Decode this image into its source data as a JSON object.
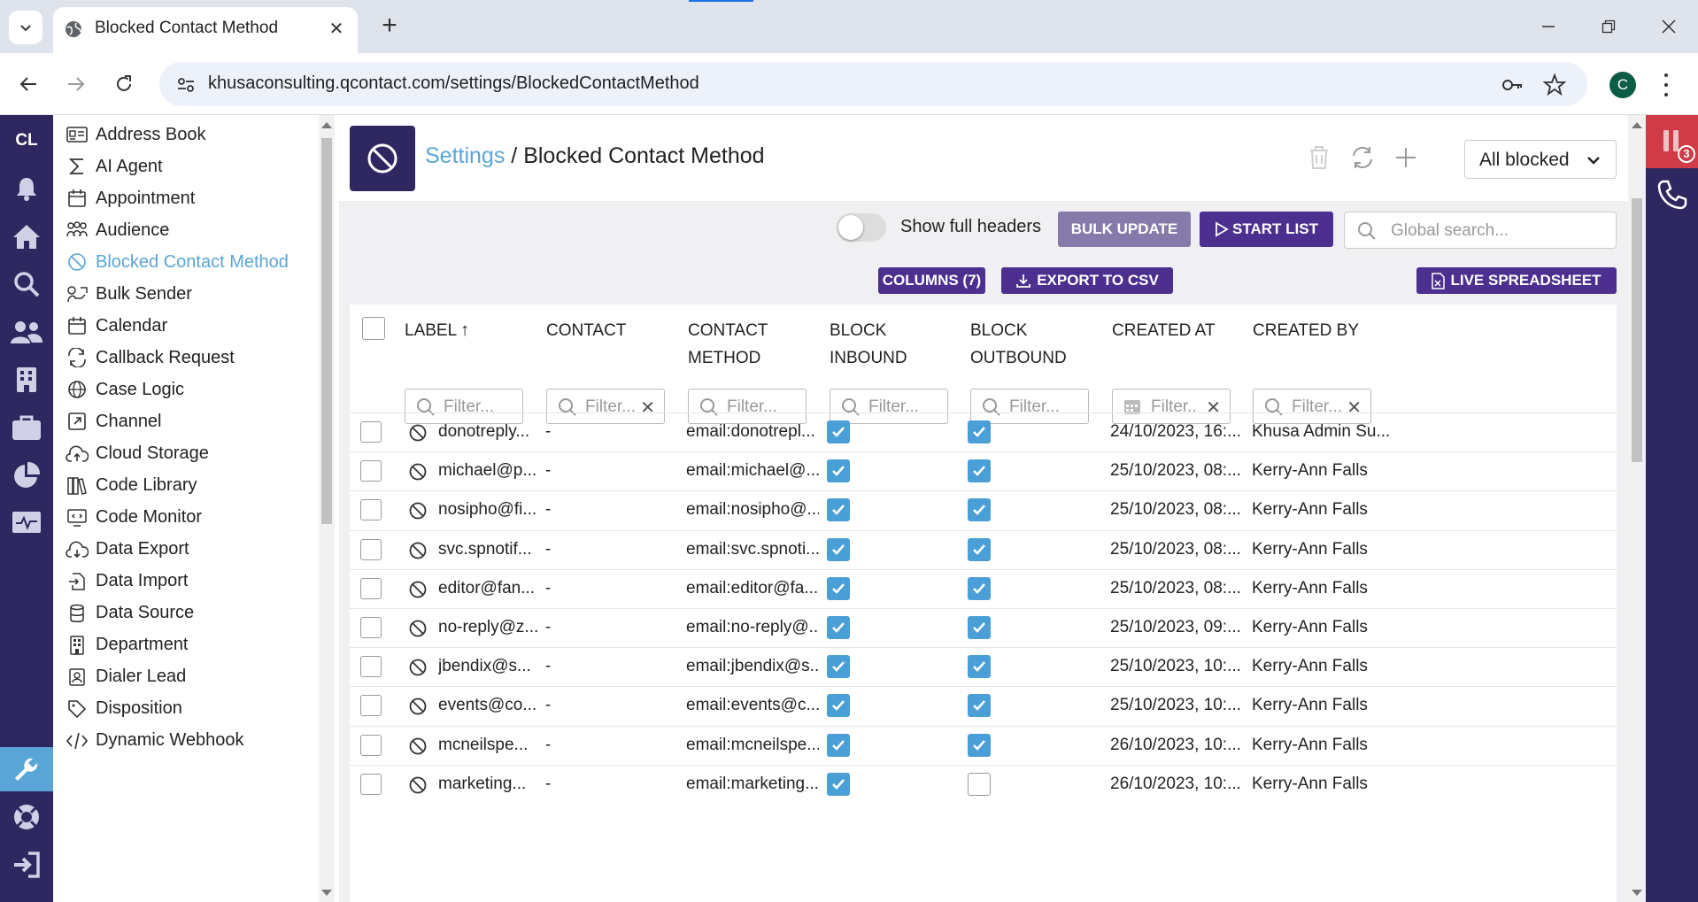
{
  "browser": {
    "tab_title": "Blocked Contact Method",
    "url": "khusaconsulting.qcontact.com/settings/BlockedContactMethod",
    "profile_initial": "C"
  },
  "app": {
    "logo": "CL",
    "rail_icons": [
      "bell-icon",
      "home-icon",
      "search-icon",
      "users-icon",
      "building-icon",
      "briefcase-icon",
      "pie-chart-icon",
      "monitor-icon",
      "wrench-icon",
      "lifebuoy-icon",
      "logout-icon"
    ],
    "active_rail": "wrench-icon",
    "notification_count": "3"
  },
  "menu": {
    "items": [
      {
        "label": "Address Book",
        "icon": "address-card-icon"
      },
      {
        "label": "AI Agent",
        "icon": "sigma-icon"
      },
      {
        "label": "Appointment",
        "icon": "calendar-icon"
      },
      {
        "label": "Audience",
        "icon": "audience-icon"
      },
      {
        "label": "Blocked Contact Method",
        "icon": "ban-icon",
        "active": true
      },
      {
        "label": "Bulk Sender",
        "icon": "bulk-sender-icon"
      },
      {
        "label": "Calendar",
        "icon": "calendar-icon"
      },
      {
        "label": "Callback Request",
        "icon": "callback-icon"
      },
      {
        "label": "Case Logic",
        "icon": "globe-icon"
      },
      {
        "label": "Channel",
        "icon": "external-link-icon"
      },
      {
        "label": "Cloud Storage",
        "icon": "cloud-upload-icon"
      },
      {
        "label": "Code Library",
        "icon": "library-icon"
      },
      {
        "label": "Code Monitor",
        "icon": "code-monitor-icon"
      },
      {
        "label": "Data Export",
        "icon": "cloud-download-icon"
      },
      {
        "label": "Data Import",
        "icon": "file-import-icon"
      },
      {
        "label": "Data Source",
        "icon": "database-icon"
      },
      {
        "label": "Department",
        "icon": "building-icon"
      },
      {
        "label": "Dialer Lead",
        "icon": "contact-card-icon"
      },
      {
        "label": "Disposition",
        "icon": "tag-icon"
      },
      {
        "label": "Dynamic Webhook",
        "icon": "code-icon"
      }
    ]
  },
  "header": {
    "breadcrumb_link": "Settings",
    "breadcrumb_sep": " / ",
    "breadcrumb_current": "Blocked Contact Method",
    "filter_dropdown": "All blocked"
  },
  "controls": {
    "toggle_label": "Show full headers",
    "toggle_on": false,
    "bulk_update": "BULK UPDATE",
    "start_list": "START LIST",
    "search_placeholder": "Global search...",
    "columns_btn": "COLUMNS (7)",
    "export_btn": "EXPORT TO CSV",
    "spreadsheet_btn": "LIVE SPREADSHEET"
  },
  "table": {
    "columns": [
      {
        "label": "LABEL",
        "sort": "asc",
        "filter_placeholder": "Filter...",
        "clearable": false,
        "filter_icon": "search-icon"
      },
      {
        "label": "CONTACT",
        "filter_placeholder": "Filter...",
        "clearable": true,
        "filter_icon": "search-icon"
      },
      {
        "label": "CONTACT METHOD",
        "filter_placeholder": "Filter...",
        "clearable": false,
        "filter_icon": "search-icon"
      },
      {
        "label": "BLOCK INBOUND",
        "filter_placeholder": "Filter...",
        "clearable": false,
        "filter_icon": "search-icon"
      },
      {
        "label": "BLOCK OUTBOUND",
        "filter_placeholder": "Filter...",
        "clearable": false,
        "filter_icon": "search-icon"
      },
      {
        "label": "CREATED AT",
        "filter_placeholder": "Filter..",
        "clearable": true,
        "filter_icon": "calendar-icon"
      },
      {
        "label": "CREATED BY",
        "filter_placeholder": "Filter...",
        "clearable": true,
        "filter_icon": "search-icon"
      }
    ],
    "rows": [
      {
        "label": "donotreply...",
        "contact": "-",
        "method": "email:donotrepl...",
        "inbound": true,
        "outbound": true,
        "created_at": "24/10/2023, 16:...",
        "created_by": "Khusa Admin Su..."
      },
      {
        "label": "michael@p...",
        "contact": "-",
        "method": "email:michael@...",
        "inbound": true,
        "outbound": true,
        "created_at": "25/10/2023, 08:...",
        "created_by": "Kerry-Ann Falls"
      },
      {
        "label": "nosipho@fi...",
        "contact": "-",
        "method": "email:nosipho@...",
        "inbound": true,
        "outbound": true,
        "created_at": "25/10/2023, 08:...",
        "created_by": "Kerry-Ann Falls"
      },
      {
        "label": "svc.spnotif...",
        "contact": "-",
        "method": "email:svc.spnoti...",
        "inbound": true,
        "outbound": true,
        "created_at": "25/10/2023, 08:...",
        "created_by": "Kerry-Ann Falls"
      },
      {
        "label": "editor@fan...",
        "contact": "-",
        "method": "email:editor@fa...",
        "inbound": true,
        "outbound": true,
        "created_at": "25/10/2023, 08:...",
        "created_by": "Kerry-Ann Falls"
      },
      {
        "label": "no-reply@z...",
        "contact": "-",
        "method": "email:no-reply@...",
        "inbound": true,
        "outbound": true,
        "created_at": "25/10/2023, 09:...",
        "created_by": "Kerry-Ann Falls"
      },
      {
        "label": "jbendix@s...",
        "contact": "-",
        "method": "email:jbendix@s...",
        "inbound": true,
        "outbound": true,
        "created_at": "25/10/2023, 10:...",
        "created_by": "Kerry-Ann Falls"
      },
      {
        "label": "events@co...",
        "contact": "-",
        "method": "email:events@c...",
        "inbound": true,
        "outbound": true,
        "created_at": "25/10/2023, 10:...",
        "created_by": "Kerry-Ann Falls"
      },
      {
        "label": "mcneilspe...",
        "contact": "-",
        "method": "email:mcneilspe...",
        "inbound": true,
        "outbound": true,
        "created_at": "26/10/2023, 10:...",
        "created_by": "Kerry-Ann Falls"
      },
      {
        "label": "marketing...",
        "contact": "-",
        "method": "email:marketing...",
        "inbound": true,
        "outbound": false,
        "created_at": "26/10/2023, 10:...",
        "created_by": "Kerry-Ann Falls"
      }
    ]
  },
  "colors": {
    "rail": "#2f2860",
    "accent": "#5aa5d8",
    "primary_button": "#4c2f8f",
    "checkbox": "#4a9fd6",
    "alert": "#cf3b46"
  }
}
